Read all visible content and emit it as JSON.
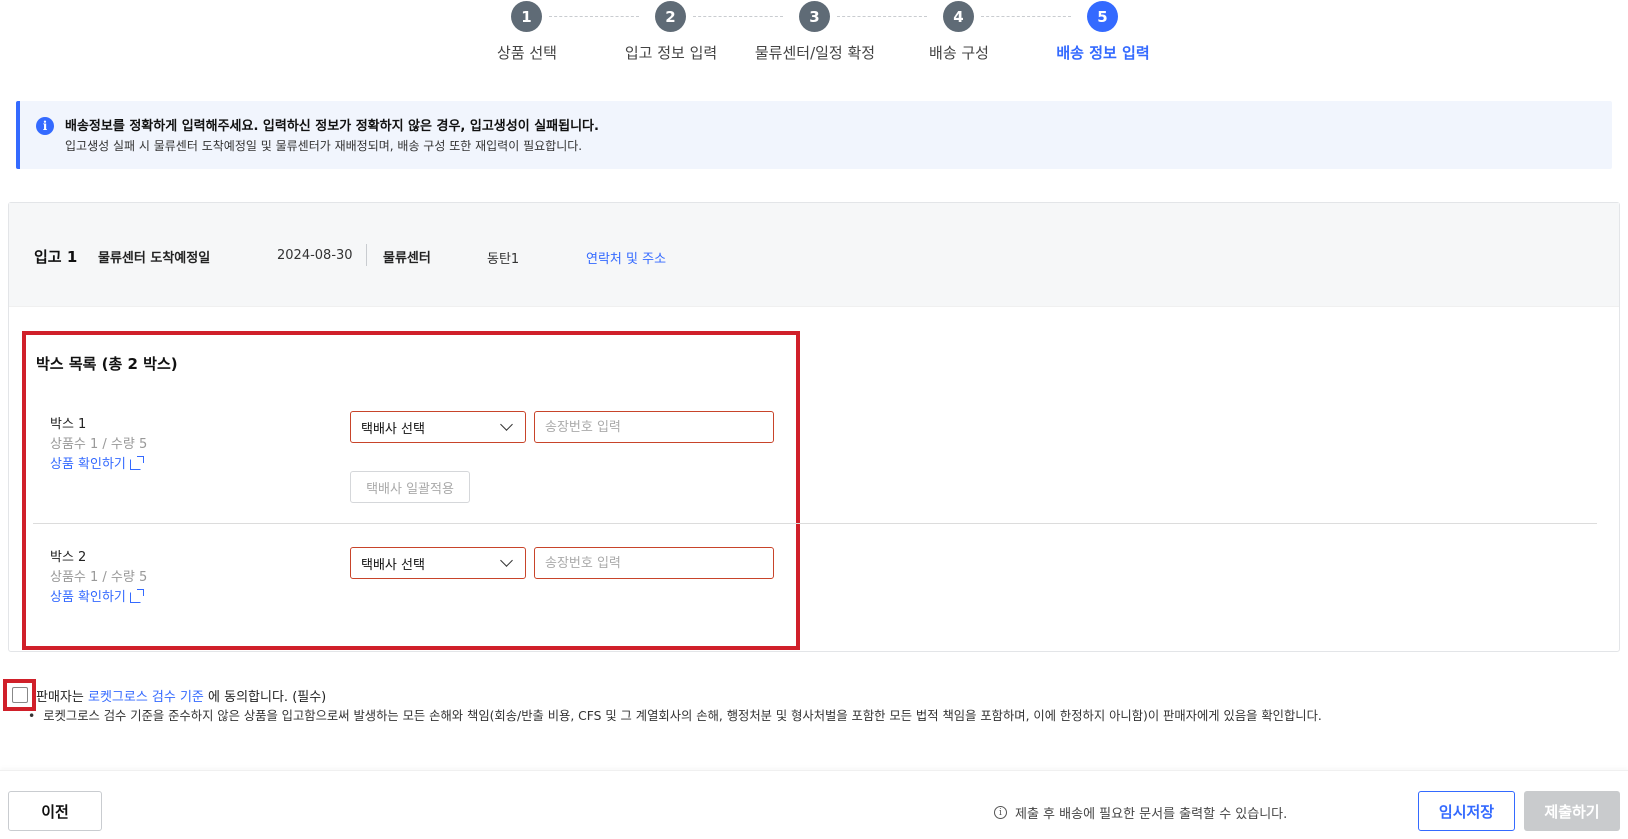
{
  "stepper": {
    "steps": [
      {
        "number": "1",
        "label": "상품 선택"
      },
      {
        "number": "2",
        "label": "입고 정보 입력"
      },
      {
        "number": "3",
        "label": "물류센터/일정 확정"
      },
      {
        "number": "4",
        "label": "배송 구성"
      },
      {
        "number": "5",
        "label": "배송 정보 입력"
      }
    ],
    "active_step": 5
  },
  "banner": {
    "icon": "info-icon",
    "title": "배송정보를 정확하게 입력해주세요. 입력하신 정보가 정확하지 않은 경우, 입고생성이 실패됩니다.",
    "description": "입고생성 실패 시 물류센터 도착예정일 및 물류센터가 재배정되며, 배송 구성 또한 재입력이 필요합니다."
  },
  "inbound": {
    "title": "입고 1",
    "arrival_label": "물류센터 도착예정일",
    "arrival_date": "2024-08-30",
    "center_label": "물류센터",
    "center_value": "동탄1",
    "contact_link": "연락처 및 주소"
  },
  "box_list": {
    "title": "박스 목록 (총 2 박스)",
    "boxes": [
      {
        "name": "박스 1",
        "meta": "상품수 1 / 수량 5",
        "link": "상품 확인하기",
        "carrier_select": "택배사 선택",
        "tracking_placeholder": "송장번호 입력"
      },
      {
        "name": "박스 2",
        "meta": "상품수 1 / 수량 5",
        "link": "상품 확인하기",
        "carrier_select": "택배사 선택",
        "tracking_placeholder": "송장번호 입력"
      }
    ],
    "bulk_apply_label": "택배사 일괄적용"
  },
  "agreement": {
    "prefix": "판매자는",
    "link": "로켓그로스 검수 기준",
    "suffix": "에 동의합니다. (필수)",
    "note": "로켓그로스 검수 기준을 준수하지 않은 상품을 입고함으로써 발생하는 모든 손해와 책임(회송/반출 비용, CFS 및 그 계열회사의 손해, 행정처분 및 형사처벌을 포함한 모든 법적 책임을 포함하며, 이에 한정하지 아니함)이 판매자에게 있음을 확인합니다."
  },
  "footer": {
    "prev_label": "이전",
    "note": "제출 후 배송에 필요한 문서를 출력할 수 있습니다.",
    "save_label": "임시저장",
    "submit_label": "제출하기"
  },
  "colors": {
    "accent": "#346aff",
    "step_inactive": "#5f6b76",
    "highlight": "#d0202a",
    "input_border": "#c8442a"
  }
}
